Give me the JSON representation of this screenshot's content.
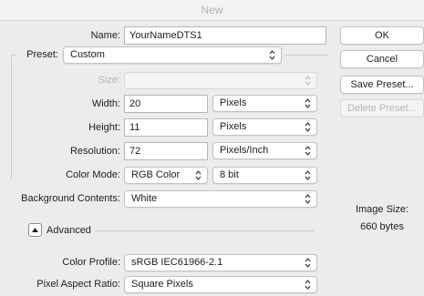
{
  "window": {
    "title": "New"
  },
  "form": {
    "name_label": "Name:",
    "name_value": "YourNameDTS1",
    "preset_label": "Preset:",
    "preset_value": "Custom",
    "size_label": "Size:",
    "size_value": "",
    "width_label": "Width:",
    "width_value": "20",
    "width_unit": "Pixels",
    "height_label": "Height:",
    "height_value": "11",
    "height_unit": "Pixels",
    "resolution_label": "Resolution:",
    "resolution_value": "72",
    "resolution_unit": "Pixels/Inch",
    "color_mode_label": "Color Mode:",
    "color_mode_value": "RGB Color",
    "bit_depth_value": "8 bit",
    "background_label": "Background Contents:",
    "background_value": "White",
    "advanced_label": "Advanced",
    "color_profile_label": "Color Profile:",
    "color_profile_value": "sRGB IEC61966-2.1",
    "pixel_aspect_label": "Pixel Aspect Ratio:",
    "pixel_aspect_value": "Square Pixels"
  },
  "buttons": {
    "ok": "OK",
    "cancel": "Cancel",
    "save_preset": "Save Preset...",
    "delete_preset": "Delete Preset..."
  },
  "info": {
    "image_size_label": "Image Size:",
    "image_size_value": "660 bytes"
  },
  "icons": {
    "select_arrows": "up-down-chevron-icon",
    "disclosure": "triangle-up-icon"
  }
}
